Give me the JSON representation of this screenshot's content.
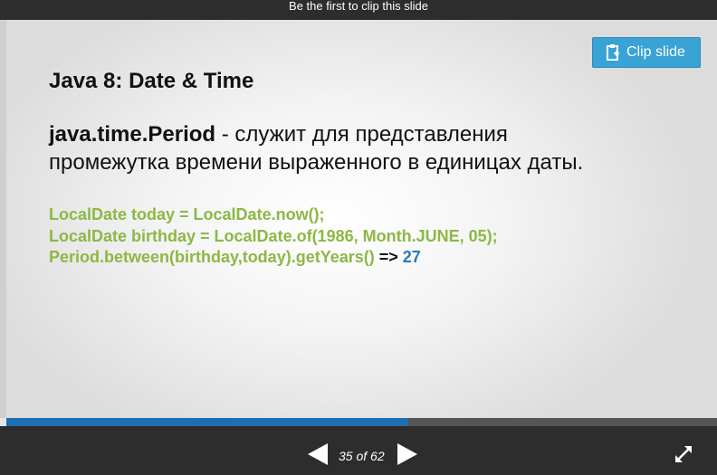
{
  "header": {
    "clip_prompt": "Be the first to clip this slide"
  },
  "slide": {
    "clip_button_label": "Clip slide",
    "title": "Java 8: Date & Time",
    "description_term": "java.time.Period",
    "description_rest_line1": " - служит для представления",
    "description_line2": "промежутка времени выраженного в единицах даты.",
    "code": {
      "line1": "LocalDate today = LocalDate.now();",
      "line2": "LocalDate birthday = LocalDate.of(1986, Month.JUNE, 05);",
      "line3": "Period.between(birthday,today).getYears()",
      "arrow": " => ",
      "result": "27"
    }
  },
  "player": {
    "page_counter": "35 of 62",
    "progress_fraction": 0.565,
    "icons": {
      "prev": "triangle-left-icon",
      "next": "triangle-right-icon",
      "fullscreen": "expand-arrows-icon",
      "clip": "clipboard-plus-icon"
    }
  },
  "colors": {
    "accent_button": "#39a3d6",
    "code_green": "#8cb845",
    "result_blue": "#2e78b6",
    "progress_blue": "#1e6fb0",
    "bar_dark": "#2d2d2d"
  }
}
